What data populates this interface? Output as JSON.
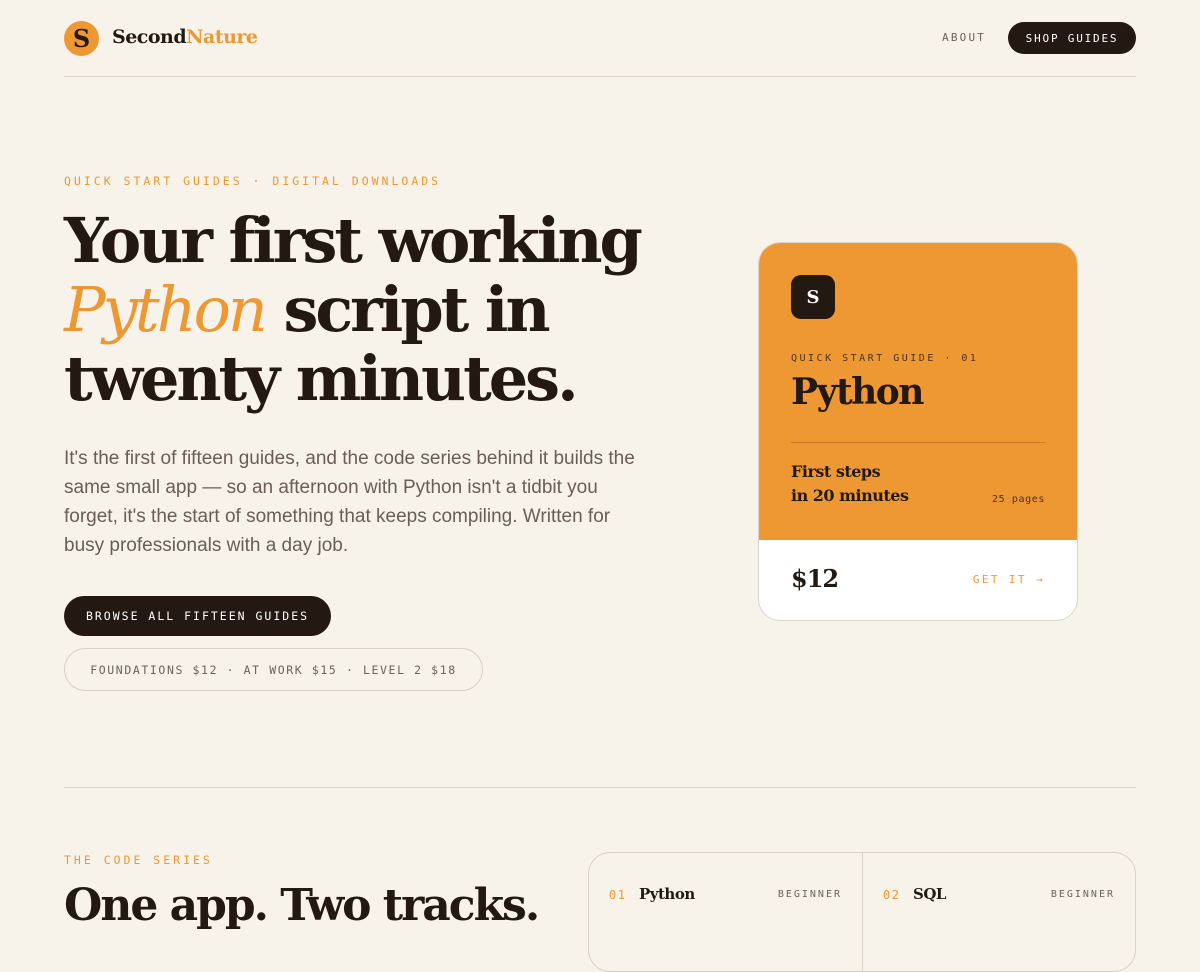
{
  "nav": {
    "logo_mark": "S",
    "brand_first": "Second",
    "brand_second": "Nature",
    "about_label": "ABOUT",
    "shop_label": "SHOP GUIDES"
  },
  "hero": {
    "eyebrow": "QUICK START GUIDES · DIGITAL DOWNLOADS",
    "headline_line1": "Your first working",
    "headline_accent": "Python",
    "headline_line2_rest": " script in",
    "headline_line3": "twenty minutes.",
    "lede": "It's the first of fifteen guides, and the code series behind it builds the same small app — so an afternoon with Python isn't a tidbit you forget, it's the start of something that keeps compiling. Written for busy professionals with a day job.",
    "browse_label": "BROWSE ALL FIFTEEN GUIDES",
    "pricing": "FOUNDATIONS $12 · AT WORK $15 · LEVEL 2 $18"
  },
  "card": {
    "badge": "S",
    "eyebrow": "QUICK START GUIDE · 01",
    "title": "Python",
    "subtitle_line1": "First steps",
    "subtitle_line2": "in 20 minutes",
    "pages": "25 pages",
    "price": "$12",
    "cta": "GET IT →"
  },
  "series": {
    "eyebrow": "THE CODE SERIES",
    "heading": "One app. Two tracks.",
    "items": [
      {
        "num": "01",
        "name": "Python",
        "level": "BEGINNER"
      },
      {
        "num": "02",
        "name": "SQL",
        "level": "BEGINNER"
      }
    ]
  },
  "colors": {
    "accent": "#ee9833",
    "ink": "#231812",
    "background": "#f7f2ea"
  }
}
